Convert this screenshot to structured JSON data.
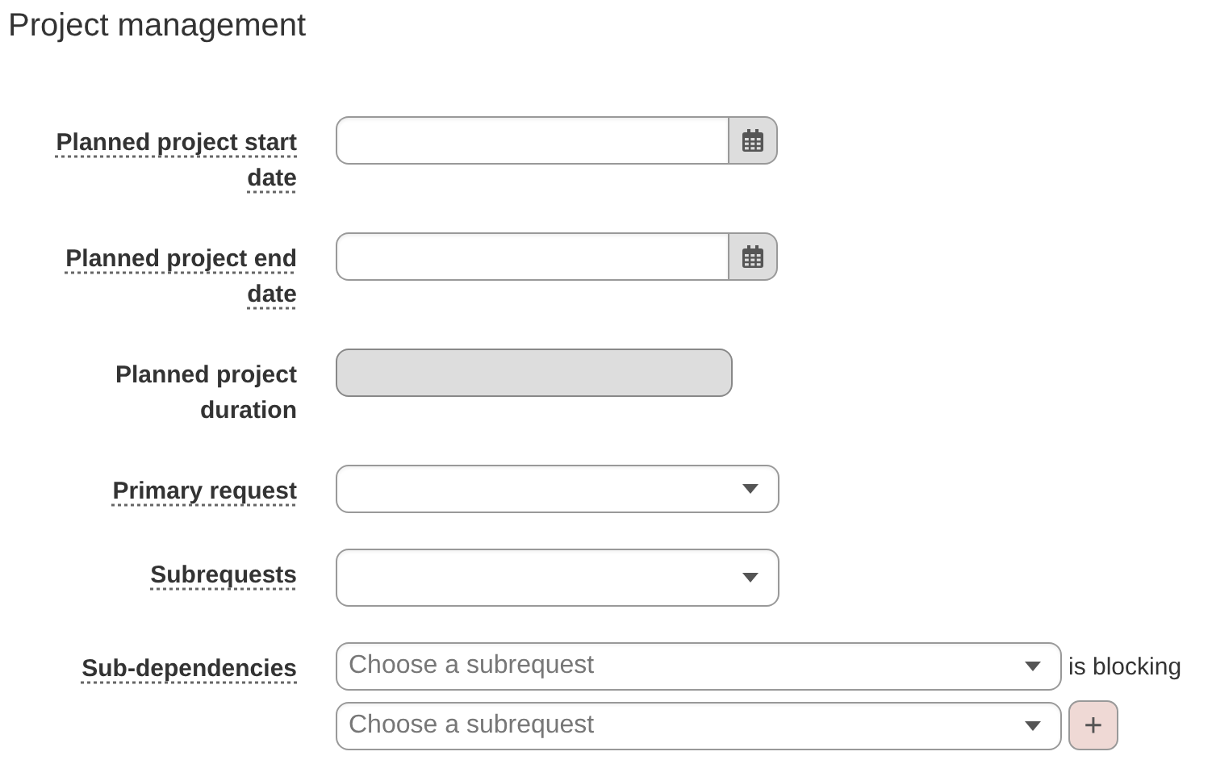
{
  "title": "Project management",
  "fields": [
    {
      "label": "Planned project start date",
      "has_help": true,
      "kind": "date"
    },
    {
      "label": "Planned project end date",
      "has_help": true,
      "kind": "date"
    },
    {
      "label": "Planned project duration",
      "has_help": false,
      "kind": "readonly"
    },
    {
      "label": "Primary request",
      "has_help": true,
      "kind": "select"
    },
    {
      "label": "Subrequests",
      "has_help": true,
      "kind": "multiselect"
    },
    {
      "label": "Sub-dependencies",
      "has_help": true,
      "kind": "dependency",
      "rows": [
        {
          "placeholder": "Choose a subrequest",
          "suffix": "is blocking"
        },
        {
          "placeholder": "Choose a subrequest",
          "action": "+"
        }
      ]
    }
  ]
}
